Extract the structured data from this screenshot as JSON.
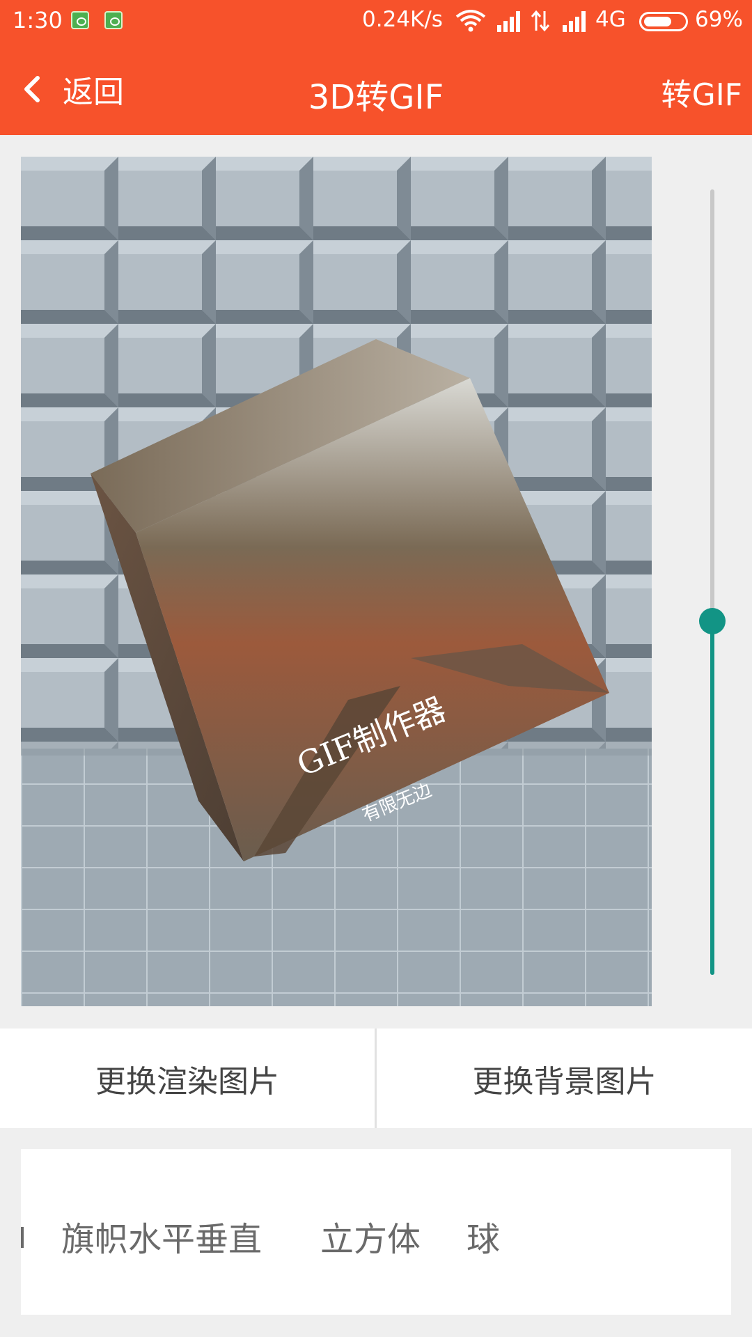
{
  "status_bar": {
    "time": "1:30",
    "net_speed": "0.24K/s",
    "network_type": "4G",
    "battery_percent": "69%",
    "battery_level": 0.69,
    "icons": [
      "notification-app-icon",
      "notification-app-icon",
      "wifi-icon",
      "signal-icon",
      "data-transfer-icon",
      "signal-icon",
      "battery-icon"
    ]
  },
  "toolbar": {
    "back_label": "返回",
    "title": "3D转GIF",
    "action_label": "转GIF",
    "color": "#f7522b"
  },
  "preview": {
    "cube_title": "GIF制作器",
    "cube_subtitle": "有限无边"
  },
  "slider": {
    "value": 0.45,
    "color": "#129485"
  },
  "actions": {
    "change_render_image": "更换渲染图片",
    "change_background_image": "更换背景图片"
  },
  "effects": {
    "items": [
      "旗帜水平垂直",
      "立方体",
      "球"
    ]
  }
}
